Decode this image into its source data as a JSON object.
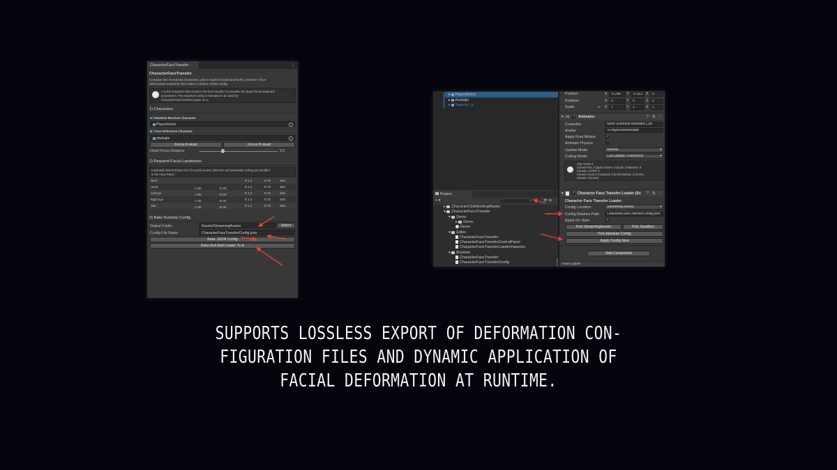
{
  "left_panel": {
    "tab_title": "CharacterFaceTransfer",
    "menu_glyph": "⋮",
    "header": "CharacterFaceTransfer",
    "desc1": "Compare two Humanoid characters, place required facial landmarks, preview A face",
    "desc2": "deformation toward B, then bake a runtime JSON config.",
    "info1": "A is the character that receives the face transfer. B provides the target facial landmark",
    "info2": "proportions. The exported config is intended to be used by",
    "info3": "CharacterFaceTransferLoader on A.",
    "sec1": "1) Characters",
    "a_label": "A / Runtime Receiver Character",
    "a_value": "PlayerDemo",
    "b_label": "B / Face Reference Character",
    "b_value": "zhubajie",
    "focus_a": "Focus A Head",
    "focus_b": "Focus B Head",
    "head_focus_label": "Head Focus Distance",
    "head_focus_value": "0.5",
    "head_focus_fraction": 0.3,
    "sec2": "2) Required Facial Landmarks",
    "lm_info1": "Landmark data is shown here for quick review. Selection and parameter editing are handled",
    "lm_info2": "in the Face Panel.",
    "landmarks": [
      {
        "name": "Neck",
        "a": "",
        "b": "",
        "r": "R 1.3",
        "n": "N 70",
        "p": "26%"
      },
      {
        "name": "Head",
        "a": "A OK",
        "b": "B OK",
        "r": "R 1.3",
        "n": "N 70",
        "p": "26%"
      },
      {
        "name": "Left Eye",
        "a": "A OK",
        "b": "B OK",
        "r": "R 1.3",
        "n": "N 70",
        "p": "26%"
      },
      {
        "name": "Right Eye",
        "a": "A OK",
        "b": "B OK",
        "r": "R 1.3",
        "n": "N 70",
        "p": "26%"
      },
      {
        "name": "Jaw",
        "a": "A OK",
        "b": "B OK",
        "r": "R 1.3",
        "n": "N 70",
        "p": "26%"
      }
    ],
    "sec3": "3) Bake Runtime Config",
    "output_label": "Output Folder",
    "output_value": "Assets/StreamingAssets",
    "select_btn": "Select",
    "config_label": "Config File Name",
    "config_value": "CharacterFaceTransferConfig.json",
    "bake_btn": "Bake JSON Config",
    "bake_add_btn": "Bake And Add Loader To A"
  },
  "right_panel": {
    "hierarchy": [
      "PlayerDemo",
      "zhubajie",
      "Superior_a"
    ],
    "project_tab": "Project",
    "search_count": "38",
    "tree": [
      "CharacterClothbindingMaster",
      "CharacterFaceTransfer",
      "Demo",
      "Demo",
      "Demo",
      "Editor",
      "CharacterFaceTransfer",
      "CharacterFaceTransferControlPanel",
      "CharacterFaceTransferLoaderInspector",
      "Runtime",
      "CharacterFaceTransfer",
      "CharacterFaceTransferConfig"
    ],
    "transform": {
      "position_label": "Position",
      "position": [
        "-0.296",
        "-0.113",
        "0"
      ],
      "rotation_label": "Rotation",
      "rotation": [
        "0",
        "0",
        "0"
      ],
      "scale_label": "Scale",
      "scale": [
        "1",
        "1",
        "1"
      ],
      "axes": [
        "X",
        "Y",
        "Z"
      ]
    },
    "animator": {
      "title": "Animator",
      "controller_label": "Controller",
      "controller_value": "None (Runtime Animator Con",
      "avatar_label": "Avatar",
      "avatar_value": "PlayerDemoAvatar",
      "root_motion_label": "Apply Root Motion",
      "physics_label": "Animate Physics",
      "update_label": "Update Mode",
      "update_value": "Normal",
      "culling_label": "Culling Mode",
      "culling_value": "Cull Update Transforms",
      "info": [
        "Clip Count: 0",
        "Curves Pos: 0 Quat: 0 Euler: 0 Scale: 0 Muscles: 0",
        "Generic: 0 PPtr: 0",
        "Curves Count: 0 Constant: 0 (0.0%) Dense: 0 (0.0%)",
        "Stream: 0 (0.0%)"
      ]
    },
    "loader": {
      "title": "Character Face Transfer Loader (Sc",
      "subtitle": "Character Face Transfer Loader",
      "location_label": "Config Location",
      "location_value": "Streaming Assets",
      "path_label": "Config Relative Path",
      "path_value": "CharacterFaceTransferConfig.json",
      "apply_label": "Apply On Start",
      "pick_streaming": "Pick StreamingAssets",
      "pick_sandbox": "Pick Sandbox",
      "pick_absolute": "Pick Absolute Config",
      "apply_now": "Apply Config Now"
    },
    "add_component": "Add Component",
    "asset_labels": "Asset Labels"
  },
  "caption": {
    "line1": "SUPPORTS LOSSLESS EXPORT OF DEFORMATION CON-",
    "line2": "FIGURATION FILES AND DYNAMIC APPLICATION OF",
    "line3": "FACIAL DEFORMATION AT RUNTIME."
  },
  "colors": {
    "arrow": "#e0442e",
    "background": "#04050c",
    "panel": "#383838"
  }
}
